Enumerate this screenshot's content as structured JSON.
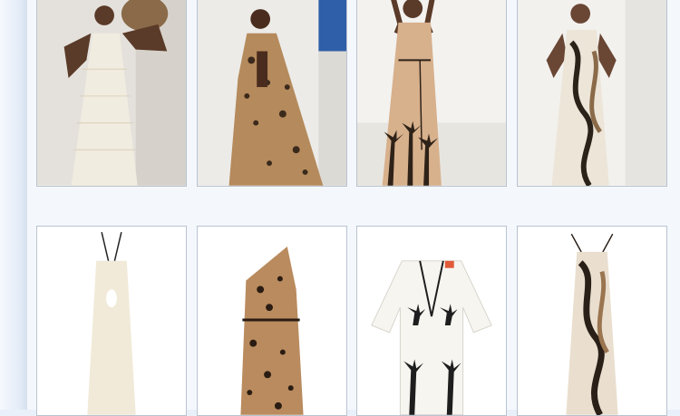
{
  "products": [
    {
      "id": "look-1",
      "row": 1,
      "style": "lifestyle",
      "dress": "crochet",
      "palette": {
        "bg": "#e4e1dc",
        "skin": "#5a3a28",
        "fabric": "#f1ece0",
        "accent": "#b89a6a"
      }
    },
    {
      "id": "look-2",
      "row": 1,
      "style": "lifestyle",
      "dress": "leopard-kaftan",
      "palette": {
        "bg": "#ecebe8",
        "skin": "#4a2c1e",
        "fabric": "#b58a5c",
        "accent": "#3a2a1c"
      }
    },
    {
      "id": "look-3",
      "row": 1,
      "style": "lifestyle",
      "dress": "palm-print",
      "palette": {
        "bg": "#f3f2ef",
        "skin": "#5a3a28",
        "fabric": "#d7b08c",
        "accent": "#2e2218"
      }
    },
    {
      "id": "look-4",
      "row": 1,
      "style": "lifestyle",
      "dress": "abstract-print",
      "palette": {
        "bg": "#f2f1ee",
        "skin": "#6a4634",
        "fabric": "#ece5d8",
        "accent": "#2b2219"
      }
    },
    {
      "id": "item-1",
      "row": 2,
      "style": "packshot",
      "dress": "halter-cream",
      "palette": {
        "bg": "#ffffff",
        "fabric": "#f1ead8",
        "accent": "#222222"
      }
    },
    {
      "id": "item-2",
      "row": 2,
      "style": "packshot",
      "dress": "leopard-one-shoulder",
      "palette": {
        "bg": "#ffffff",
        "fabric": "#b98b5e",
        "accent": "#2a1c12"
      }
    },
    {
      "id": "item-3",
      "row": 2,
      "style": "packshot",
      "dress": "palm-robe",
      "palette": {
        "bg": "#ffffff",
        "fabric": "#f7f5f0",
        "accent": "#1e1e1e"
      }
    },
    {
      "id": "item-4",
      "row": 2,
      "style": "packshot",
      "dress": "abstract-halter",
      "palette": {
        "bg": "#ffffff",
        "fabric": "#eadfcf",
        "accent": "#2a2018"
      }
    }
  ]
}
